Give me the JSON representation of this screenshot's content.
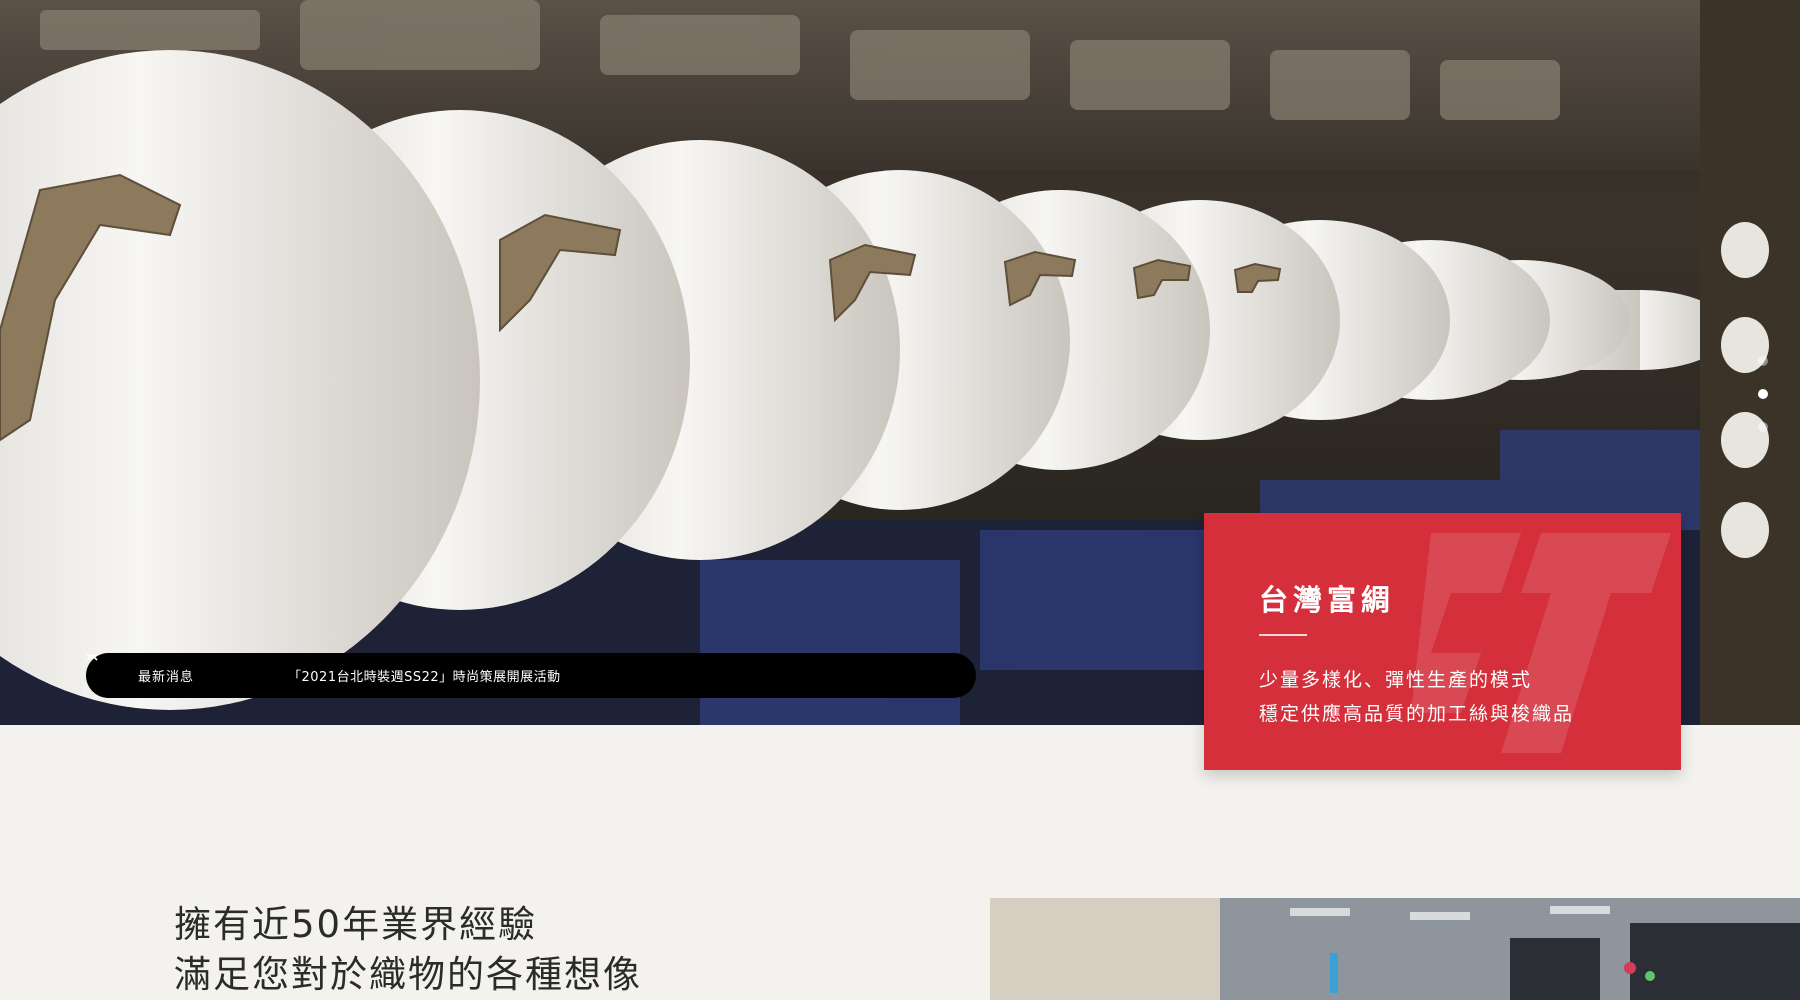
{
  "hero": {
    "news": {
      "label": "最新消息",
      "headline": "「2021台北時裝週SS22」時尚策展開展活動",
      "prev_icon": "chevron-up-icon",
      "next_icon": "chevron-down-icon"
    },
    "slides": {
      "count": 3,
      "active_index": 1
    }
  },
  "intro_card": {
    "title": "台灣富綢",
    "line1": "少量多樣化、彈性生產的模式",
    "line2": "穩定供應高品質的加工絲與梭織品",
    "color": "#d42f3b"
  },
  "about": {
    "headline_line1": "擁有近50年業界經驗",
    "headline_line2": "滿足您對於織物的各種想像"
  },
  "colors": {
    "background": "#f4f2ee",
    "accent_red": "#d42f3b",
    "news_bar": "#000000"
  }
}
